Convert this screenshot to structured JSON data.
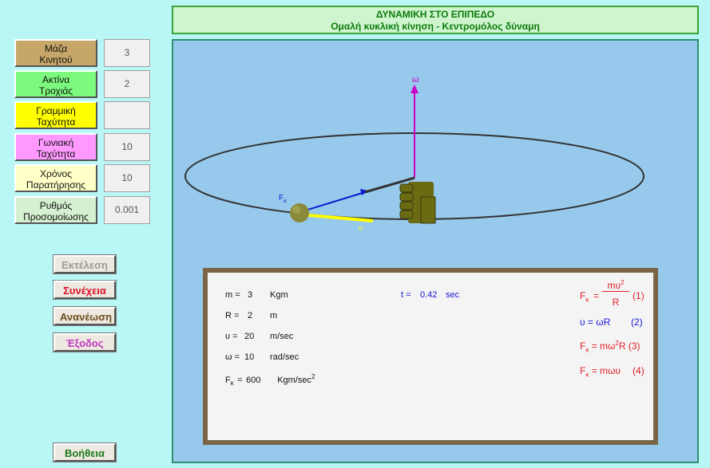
{
  "header": {
    "title": "ΔΥΝΑΜΙΚΗ ΣΤΟ ΕΠΙΠΕΔΟ",
    "subtitle": "Ομαλή κυκλική κίνηση  - Κεντρομόλος δύναμη"
  },
  "params": [
    {
      "label_line1": "Μάζα",
      "label_line2": "Κινητού",
      "value": "3",
      "color": "#c6a769"
    },
    {
      "label_line1": "Ακτίνα",
      "label_line2": "Τροχιάς",
      "value": "2",
      "color": "#7dfa7d"
    },
    {
      "label_line1": "Γραμμική",
      "label_line2": "Ταχύτητα",
      "value": "",
      "color": "#ffff00"
    },
    {
      "label_line1": "Γωνιακή",
      "label_line2": "Ταχύτητα",
      "value": "10",
      "color": "#ff99ff"
    },
    {
      "label_line1": "Χρόνος",
      "label_line2": "Παρατήρησης",
      "value": "10",
      "color": "#ffffc8"
    },
    {
      "label_line1": "Ρυθμός",
      "label_line2": "Προσομοίωσης",
      "value": "0.001",
      "color": "#d4f0d0"
    }
  ],
  "buttons": {
    "run": {
      "label": "Εκτέλεση",
      "color": "#9a9a9a"
    },
    "continue": {
      "label": "Συνέχεια",
      "color": "#e0102a"
    },
    "refresh": {
      "label": "Ανανέωση",
      "color": "#6e4e1e"
    },
    "exit": {
      "label": "Έξοδος",
      "color": "#c032c0"
    },
    "help": {
      "label": "Βοήθεια",
      "color": "#1b7a1b"
    }
  },
  "simulation": {
    "omega_label": "ω",
    "force_label": "F",
    "force_sub": "κ",
    "velocity_label": "υ"
  },
  "info": {
    "rows": [
      {
        "name": "m =",
        "value": "3",
        "unit": "Kgm"
      },
      {
        "name": "R =",
        "value": "2",
        "unit": "m"
      },
      {
        "name": "υ =",
        "value": "20",
        "unit": "m/sec"
      },
      {
        "name": "ω =",
        "value": "10",
        "unit": "rad/sec"
      },
      {
        "name": "F",
        "sub": "κ",
        "eq": "=",
        "value": "600",
        "unit": "Kgm/sec",
        "unit_sup": "2"
      }
    ],
    "time": {
      "name": "t =",
      "value": "0.42",
      "unit": "sec"
    },
    "equations": {
      "eq1": {
        "lhs": "F",
        "sub": "κ",
        "eq": "=",
        "num": "mυ",
        "num_sup": "2",
        "den": "R",
        "tag": "(1)"
      },
      "eq2": {
        "text": "υ = ωR",
        "tag": "(2)"
      },
      "eq3": {
        "lhs": "F",
        "sub": "κ",
        "eq": "= mω",
        "sup": "2",
        "after": "R",
        "tag": "(3)"
      },
      "eq4": {
        "lhs": "F",
        "sub": "κ",
        "eq": "= mωυ",
        "tag": "(4)"
      }
    }
  },
  "colors": {
    "omega_vector": "#cc00cc",
    "force_vector": "#0a1ad0",
    "velocity_vector": "#ffff00",
    "ball": "#8a8a3a",
    "hand": "#6b6b14",
    "eq_red": "#e0202a",
    "eq_blue": "#1616d6"
  }
}
